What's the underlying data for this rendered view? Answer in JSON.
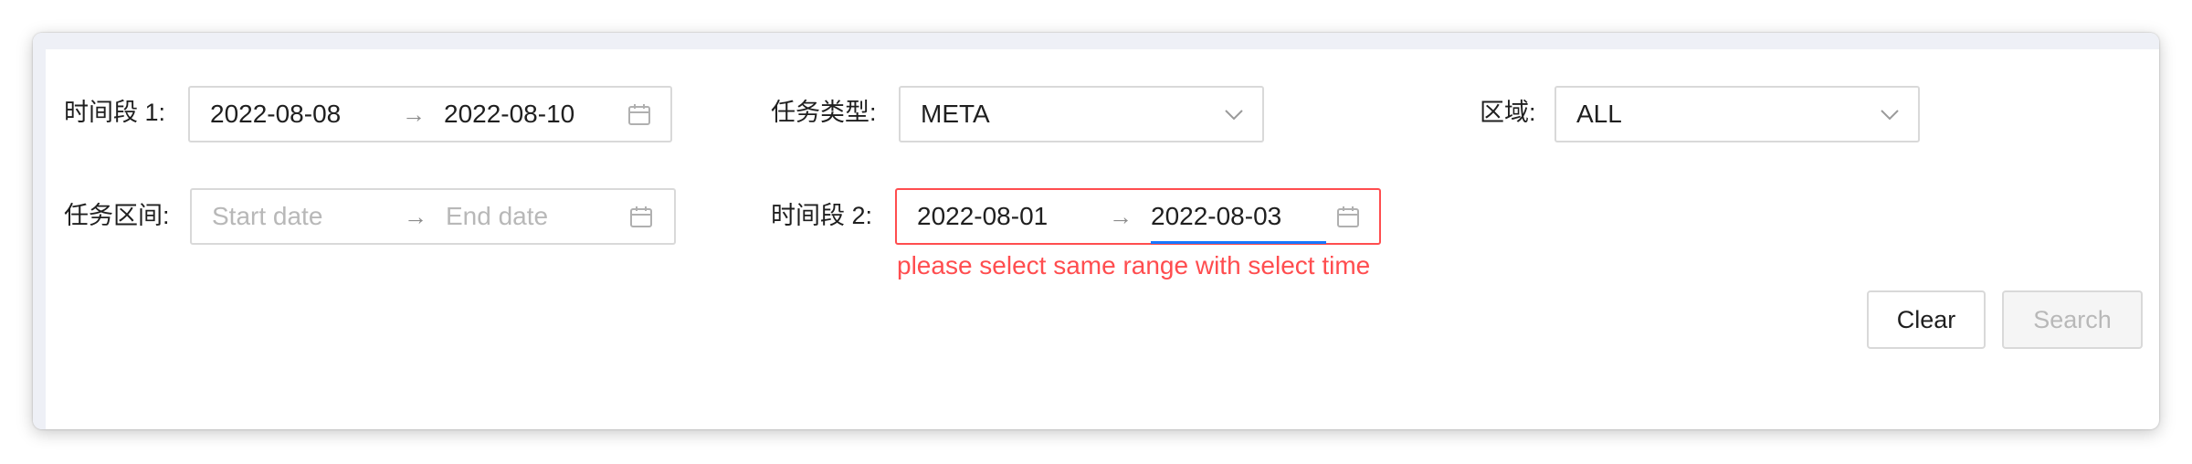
{
  "filters": {
    "period1": {
      "label": "时间段 1:",
      "start": "2022-08-08",
      "end": "2022-08-10",
      "separator": "→"
    },
    "task_type": {
      "label": "任务类型:",
      "value": "META"
    },
    "region": {
      "label": "区域:",
      "value": "ALL"
    },
    "task_range": {
      "label": "任务区间:",
      "start_placeholder": "Start date",
      "end_placeholder": "End date",
      "separator": "→"
    },
    "period2": {
      "label": "时间段 2:",
      "start": "2022-08-01",
      "end": "2022-08-03",
      "separator": "→",
      "error": "please select same range with select time"
    }
  },
  "actions": {
    "clear_label": "Clear",
    "search_label": "Search"
  },
  "colors": {
    "error": "#ff4d4f",
    "accent": "#1677ff",
    "border": "#d9d9d9"
  },
  "icons": {
    "calendar": "calendar-icon",
    "dropdown": "chevron-down-icon"
  }
}
